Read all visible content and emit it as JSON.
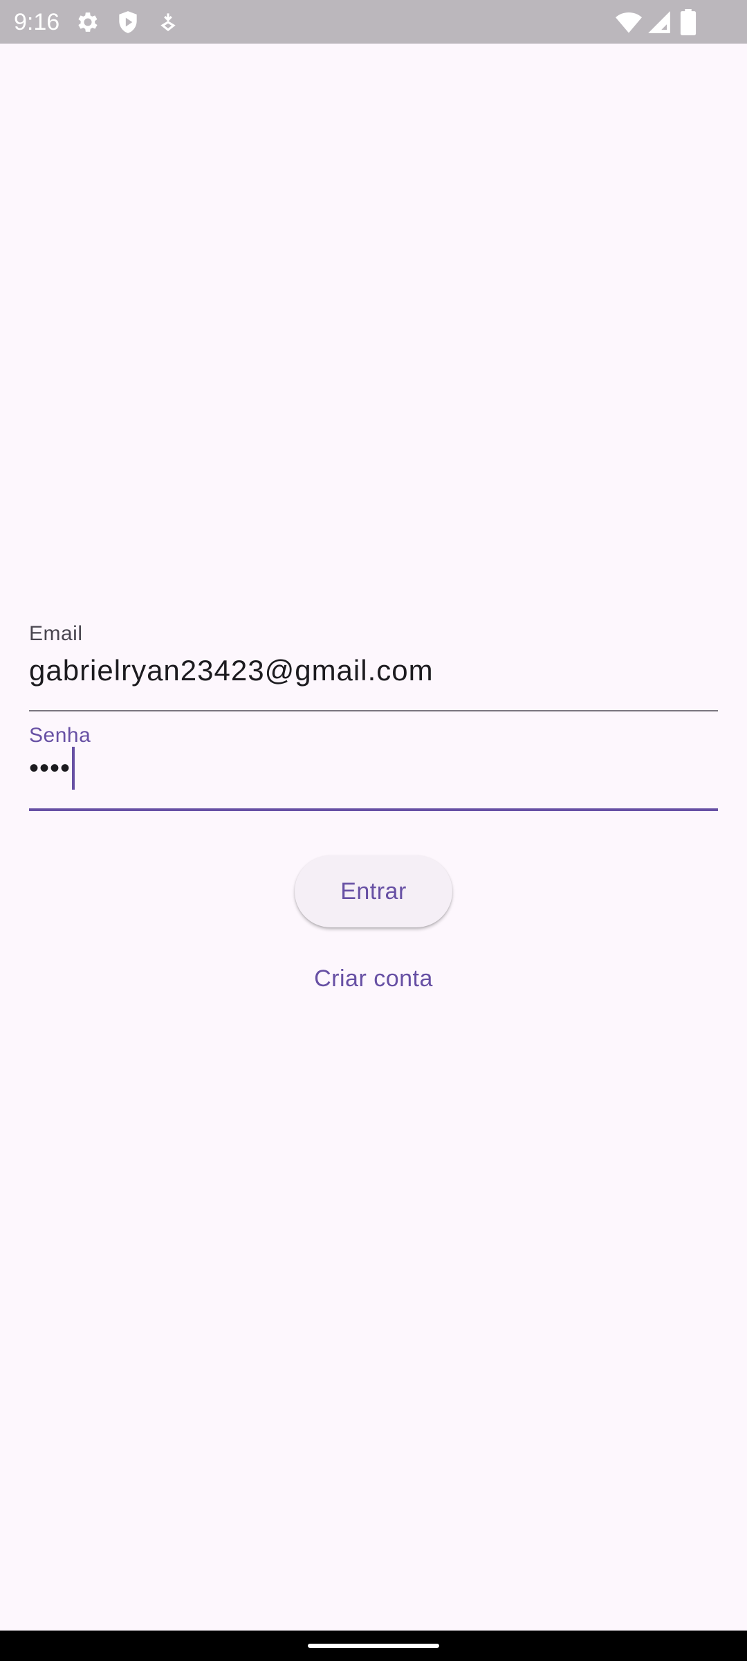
{
  "status_bar": {
    "time": "9:16",
    "left_icons": [
      "gear-icon",
      "shield-icon",
      "download-icon"
    ],
    "right_icons": [
      "wifi-icon",
      "signal-icon",
      "battery-icon"
    ],
    "background_color": "#bbb7bc"
  },
  "login_form": {
    "email": {
      "label": "Email",
      "value": "gabrielryan23423@gmail.com"
    },
    "password": {
      "label": "Senha",
      "value": "••••",
      "focused": true
    },
    "submit_label": "Entrar",
    "create_account_label": "Criar conta"
  },
  "colors": {
    "background": "#fdf7fd",
    "accent": "#6750a4",
    "text": "#1c1b1f",
    "label": "#49454f",
    "button_surface": "#f5eff6"
  }
}
